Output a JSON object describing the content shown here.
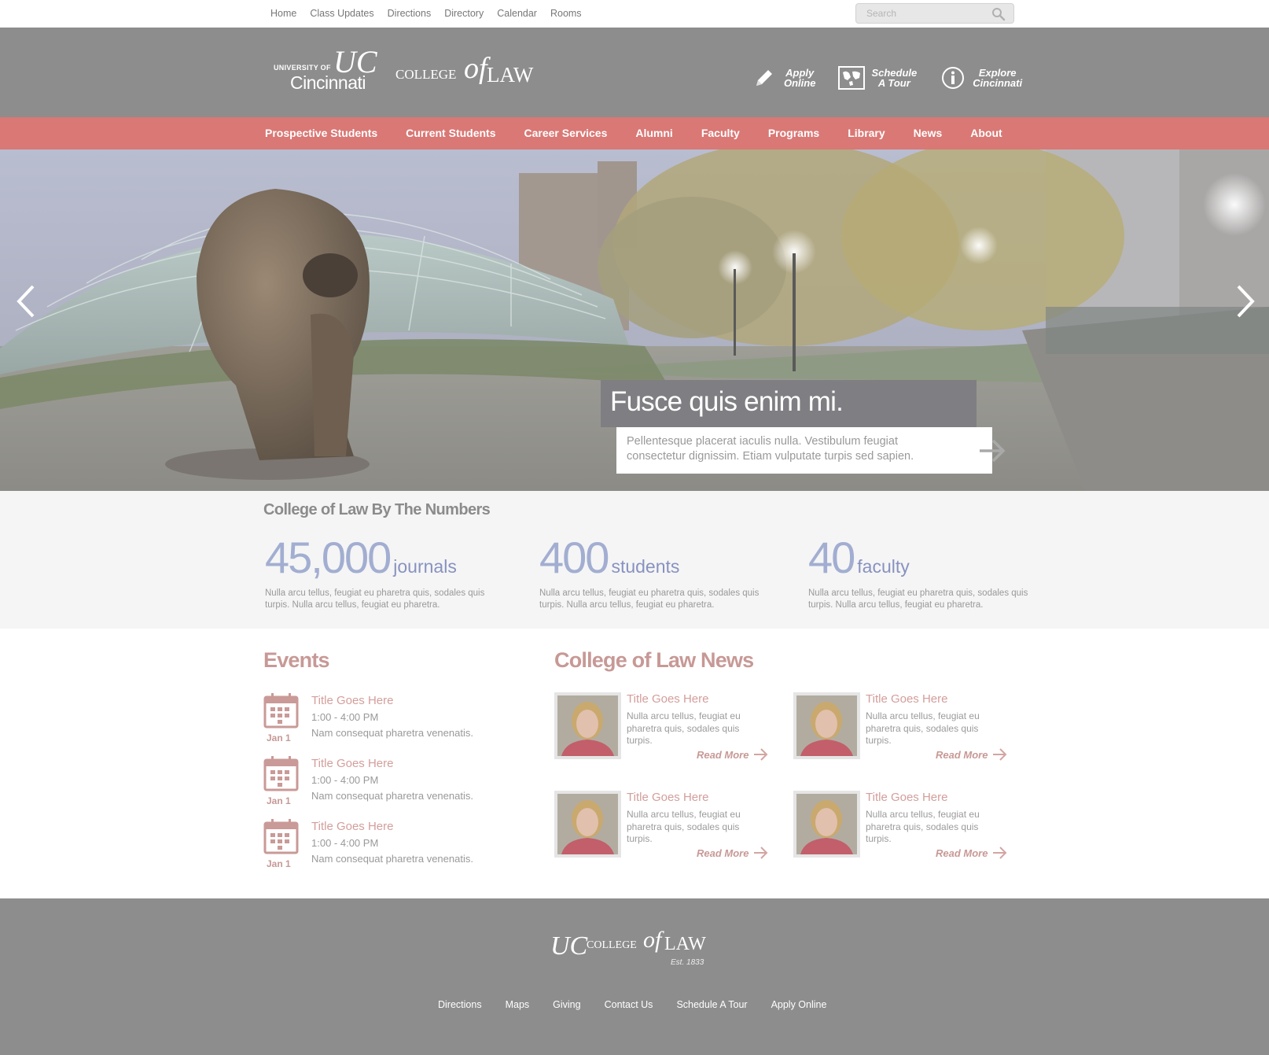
{
  "util_nav": [
    "Home",
    "Class Updates",
    "Directions",
    "Directory",
    "Calendar",
    "Rooms"
  ],
  "search": {
    "placeholder": "Search"
  },
  "logo": {
    "university_small": "UNIVERSITY OF",
    "university_big": "Cincinnati",
    "college": "COLLEGE",
    "of": "of",
    "law": "LAW"
  },
  "quick_links": [
    {
      "icon": "pencil-icon",
      "line1": "Apply",
      "line2": "Online"
    },
    {
      "icon": "map-icon",
      "line1": "Schedule",
      "line2": "A Tour"
    },
    {
      "icon": "info-icon",
      "line1": "Explore",
      "line2": "Cincinnati"
    }
  ],
  "main_nav": [
    "Prospective Students",
    "Current Students",
    "Career Services",
    "Alumni",
    "Faculty",
    "Programs",
    "Library",
    "News",
    "About"
  ],
  "hero": {
    "title": "Fusce quis enim mi.",
    "body": "Pellentesque placerat iaculis nulla. Vestibulum feugiat consectetur dignissim. Etiam vulputate turpis sed sapien."
  },
  "numbers": {
    "title": "College of Law By The Numbers",
    "stats": [
      {
        "value": "45,000",
        "unit": "journals",
        "desc": "Nulla arcu tellus, feugiat eu pharetra quis, sodales quis turpis. Nulla arcu tellus, feugiat eu pharetra."
      },
      {
        "value": "400",
        "unit": "students",
        "desc": "Nulla arcu tellus, feugiat eu pharetra quis, sodales quis turpis. Nulla arcu tellus, feugiat eu pharetra."
      },
      {
        "value": "40",
        "unit": "faculty",
        "desc": "Nulla arcu tellus, feugiat eu pharetra quis, sodales quis turpis. Nulla arcu tellus, feugiat eu pharetra."
      }
    ]
  },
  "events": {
    "title": "Events",
    "items": [
      {
        "date": "Jan 1",
        "title": "Title Goes Here",
        "time": "1:00 - 4:00 PM",
        "desc": "Nam consequat pharetra venenatis."
      },
      {
        "date": "Jan 1",
        "title": "Title Goes Here",
        "time": "1:00 - 4:00 PM",
        "desc": "Nam consequat pharetra venenatis."
      },
      {
        "date": "Jan 1",
        "title": "Title Goes Here",
        "time": "1:00 - 4:00 PM",
        "desc": "Nam consequat pharetra venenatis."
      }
    ]
  },
  "news": {
    "title": "College of Law News",
    "items": [
      {
        "title": "Title Goes Here",
        "desc": "Nulla arcu tellus, feugiat eu pharetra quis, sodales quis turpis.",
        "more": "Read More"
      },
      {
        "title": "Title Goes Here",
        "desc": "Nulla arcu tellus, feugiat eu pharetra quis, sodales quis turpis.",
        "more": "Read More"
      },
      {
        "title": "Title Goes Here",
        "desc": "Nulla arcu tellus, feugiat eu pharetra quis, sodales quis turpis.",
        "more": "Read More"
      },
      {
        "title": "Title Goes Here",
        "desc": "Nulla arcu tellus, feugiat eu pharetra quis, sodales quis turpis.",
        "more": "Read More"
      }
    ]
  },
  "footer": {
    "logo_college": "COLLEGE",
    "logo_of": "of",
    "logo_law": "LAW",
    "est": "Est. 1833",
    "links": [
      "Directions",
      "Maps",
      "Giving",
      "Contact Us",
      "Schedule A Tour",
      "Apply Online"
    ]
  },
  "colors": {
    "nav_bg": "#d97875",
    "header_bg": "#8d8d8d",
    "accent_text": "#c79996",
    "stat_blue": "#a2aed1"
  }
}
